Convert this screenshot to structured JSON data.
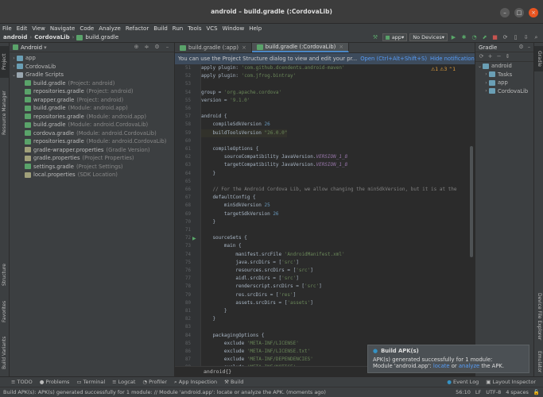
{
  "window": {
    "title": "android – build.gradle (:CordovaLib)"
  },
  "menu": [
    "File",
    "Edit",
    "View",
    "Navigate",
    "Code",
    "Analyze",
    "Refactor",
    "Build",
    "Run",
    "Tools",
    "VCS",
    "Window",
    "Help"
  ],
  "nav": {
    "crumbs": [
      "android",
      "CordovaLib",
      "build.gradle"
    ],
    "config": "app",
    "device": "No Devices"
  },
  "project": {
    "header": "Android",
    "tree": [
      {
        "indent": 0,
        "arrow": "›",
        "label": "app",
        "hint": "",
        "color": "#6a9fb5"
      },
      {
        "indent": 0,
        "arrow": "›",
        "label": "CordovaLib",
        "hint": "",
        "color": "#6a9fb5"
      },
      {
        "indent": 0,
        "arrow": "⌄",
        "label": "Gradle Scripts",
        "hint": "",
        "color": "#9aa7b0"
      },
      {
        "indent": 1,
        "arrow": "",
        "label": "build.gradle",
        "hint": "(Project: android)",
        "color": "#5aa36a"
      },
      {
        "indent": 1,
        "arrow": "",
        "label": "repositories.gradle",
        "hint": "(Project: android)",
        "color": "#5aa36a"
      },
      {
        "indent": 1,
        "arrow": "",
        "label": "wrapper.gradle",
        "hint": "(Project: android)",
        "color": "#5aa36a"
      },
      {
        "indent": 1,
        "arrow": "",
        "label": "build.gradle",
        "hint": "(Module: android.app)",
        "color": "#5aa36a"
      },
      {
        "indent": 1,
        "arrow": "",
        "label": "repositories.gradle",
        "hint": "(Module: android.app)",
        "color": "#5aa36a"
      },
      {
        "indent": 1,
        "arrow": "",
        "label": "build.gradle",
        "hint": "(Module: android.CordovaLib)",
        "color": "#5aa36a"
      },
      {
        "indent": 1,
        "arrow": "",
        "label": "cordova.gradle",
        "hint": "(Module: android.CordovaLib)",
        "color": "#5aa36a"
      },
      {
        "indent": 1,
        "arrow": "",
        "label": "repositories.gradle",
        "hint": "(Module: android.CordovaLib)",
        "color": "#5aa36a"
      },
      {
        "indent": 1,
        "arrow": "",
        "label": "gradle-wrapper.properties",
        "hint": "(Gradle Version)",
        "color": "#a0a07a"
      },
      {
        "indent": 1,
        "arrow": "",
        "label": "gradle.properties",
        "hint": "(Project Properties)",
        "color": "#a0a07a"
      },
      {
        "indent": 1,
        "arrow": "",
        "label": "settings.gradle",
        "hint": "(Project Settings)",
        "color": "#5aa36a"
      },
      {
        "indent": 1,
        "arrow": "",
        "label": "local.properties",
        "hint": "(SDK Location)",
        "color": "#a0a07a"
      }
    ]
  },
  "leftTabs": [
    "Project",
    "Resource Manager",
    "Structure",
    "Favorites",
    "Build Variants"
  ],
  "rightTabs": [
    "Gradle",
    "Device File Explorer",
    "Emulator"
  ],
  "editor": {
    "tabs": [
      "build.gradle (:app)",
      "build.gradle (:CordovaLib)"
    ],
    "notice": "You can use the Project Structure dialog to view and edit your pr...",
    "notice_link1": "Open (Ctrl+Alt+Shift+S)",
    "notice_link2": "Hide notification",
    "inspection": "⚠1 ⚠3 ⌃1",
    "lines": [
      {
        "n": "51",
        "t": "<span class='cl0'>apply plugin: </span><span class='str'>'com.github.dcendents.android-maven'</span>"
      },
      {
        "n": "52",
        "t": "apply plugin: <span class='str'>'com.jfrog.bintray'</span>"
      },
      {
        "n": "53",
        "t": ""
      },
      {
        "n": "54",
        "t": "group = <span class='str'>'org.apache.cordova'</span>"
      },
      {
        "n": "55",
        "t": "version = <span class='str'>'9.1.0'</span>"
      },
      {
        "n": "56",
        "t": ""
      },
      {
        "n": "57",
        "t": "android {"
      },
      {
        "n": "58",
        "t": "    compileSdkVersion <span class='num'>26</span>"
      },
      {
        "n": "59",
        "t": "    buildToolsVersion <span class='str'>\"26.0.0\"</span>"
      },
      {
        "n": "60",
        "t": ""
      },
      {
        "n": "61",
        "t": "    compileOptions {"
      },
      {
        "n": "62",
        "t": "        sourceCompatibility JavaVersion.<span class='it'>VERSION_1_8</span>"
      },
      {
        "n": "63",
        "t": "        targetCompatibility JavaVersion.<span class='it'>VERSION_1_8</span>"
      },
      {
        "n": "64",
        "t": "    }"
      },
      {
        "n": "65",
        "t": ""
      },
      {
        "n": "66",
        "t": "    <span class='cmt'>// For the Android Cordova Lib, we allow changing the minSdkVersion, but it is at the</span>"
      },
      {
        "n": "67",
        "t": "    defaultConfig {"
      },
      {
        "n": "68",
        "t": "        minSdkVersion <span class='num'>25</span>"
      },
      {
        "n": "69",
        "t": "        targetSdkVersion <span class='num'>26</span>"
      },
      {
        "n": "70",
        "t": "    }"
      },
      {
        "n": "71",
        "t": ""
      },
      {
        "n": "72",
        "t": "    sourceSets {"
      },
      {
        "n": "73",
        "t": "        main {"
      },
      {
        "n": "74",
        "t": "            manifest.srcFile <span class='str'>'AndroidManifest.xml'</span>"
      },
      {
        "n": "75",
        "t": "            java.srcDirs = [<span class='str'>'src'</span>]"
      },
      {
        "n": "76",
        "t": "            resources.srcDirs = [<span class='str'>'src'</span>]"
      },
      {
        "n": "77",
        "t": "            aidl.srcDirs = [<span class='str'>'src'</span>]"
      },
      {
        "n": "78",
        "t": "            renderscript.srcDirs = [<span class='str'>'src'</span>]"
      },
      {
        "n": "79",
        "t": "            res.srcDirs = [<span class='str'>'res'</span>]"
      },
      {
        "n": "80",
        "t": "            assets.srcDirs = [<span class='str'>'assets'</span>]"
      },
      {
        "n": "81",
        "t": "        }"
      },
      {
        "n": "82",
        "t": "    }"
      },
      {
        "n": "83",
        "t": ""
      },
      {
        "n": "84",
        "t": "    packagingOptions {"
      },
      {
        "n": "85",
        "t": "        exclude <span class='str'>'META-INF/LICENSE'</span>"
      },
      {
        "n": "86",
        "t": "        exclude <span class='str'>'META-INF/LICENSE.txt'</span>"
      },
      {
        "n": "87",
        "t": "        exclude <span class='str'>'META-INF/DEPENDENCIES'</span>"
      },
      {
        "n": "88",
        "t": "        exclude <span class='str'>'META-INF/NOTICE'</span>"
      }
    ],
    "breadcrumb": "android{}"
  },
  "gradle": {
    "title": "Gradle",
    "tree": [
      {
        "label": "android",
        "indent": 0,
        "arrow": "⌄"
      },
      {
        "label": "Tasks",
        "indent": 1,
        "arrow": "›"
      },
      {
        "label": "app",
        "indent": 1,
        "arrow": "›"
      },
      {
        "label": "CordovaLib",
        "indent": 1,
        "arrow": "›"
      }
    ]
  },
  "bottomTabs": [
    "TODO",
    "Problems",
    "Terminal",
    "Logcat",
    "Profiler",
    "App Inspection",
    "Build"
  ],
  "bottomRight": [
    "Event Log",
    "Layout Inspector"
  ],
  "status": {
    "message": "Build APK(s): APK(s) generated successfully for 1 module: // Module 'android.app': locate or analyze the APK. (moments ago)",
    "position": "56:10",
    "lf": "LF",
    "enc": "UTF-8",
    "indent": "4 spaces"
  },
  "balloon": {
    "title": "Build APK(s)",
    "line1": "APK(s) generated successfully for 1 module:",
    "line2_pre": "Module 'android.app': ",
    "link_locate": "locate",
    "line2_mid": " or ",
    "link_analyze": "analyze",
    "line2_post": " the APK."
  }
}
